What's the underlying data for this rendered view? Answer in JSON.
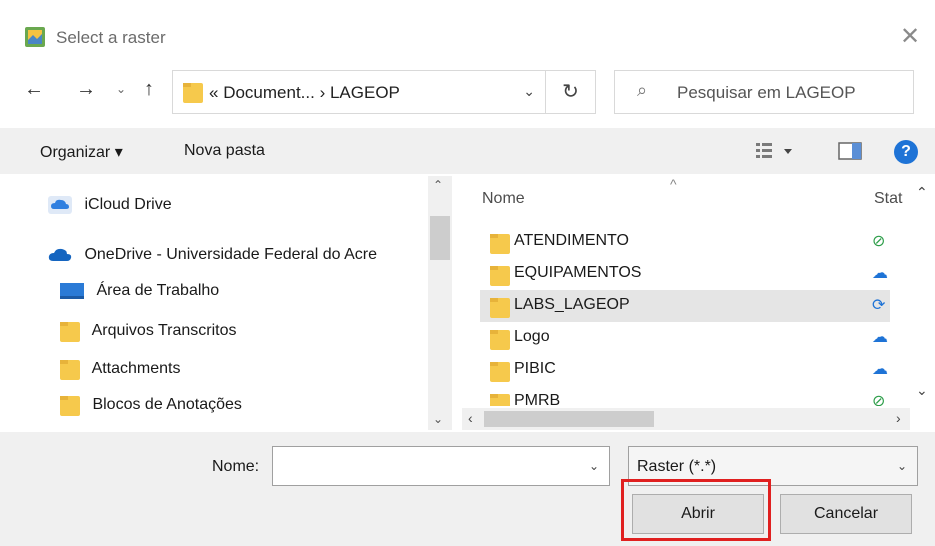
{
  "window": {
    "title": "Select a raster",
    "close_icon": "close-icon"
  },
  "nav": {
    "address_chevron": "«",
    "address_path": "Document... › LAGEOP",
    "search_placeholder": "Pesquisar em LAGEOP"
  },
  "toolbar": {
    "organize_label": "Organizar ▾",
    "new_folder_label": "Nova pasta",
    "help_label": "?"
  },
  "sidebar": {
    "items": [
      {
        "label": "iCloud Drive",
        "icon": "icloud-icon"
      },
      {
        "label": "OneDrive - Universidade Federal do Acre",
        "icon": "onedrive-icon"
      },
      {
        "label": "Área de Trabalho",
        "icon": "desktop-icon"
      },
      {
        "label": "Arquivos Transcritos",
        "icon": "folder-icon"
      },
      {
        "label": "Attachments",
        "icon": "folder-icon"
      },
      {
        "label": "Blocos de Anotações",
        "icon": "folder-icon"
      }
    ]
  },
  "filelist": {
    "columns": {
      "name": "Nome",
      "status": "Stat"
    },
    "rows": [
      {
        "name": "ATENDIMENTO",
        "status": "synced"
      },
      {
        "name": "EQUIPAMENTOS",
        "status": "cloud"
      },
      {
        "name": "LABS_LAGEOP",
        "status": "syncing"
      },
      {
        "name": "Logo",
        "status": "cloud"
      },
      {
        "name": "PIBIC",
        "status": "cloud"
      },
      {
        "name": "PMRB",
        "status": "synced"
      }
    ],
    "selected_index": 2
  },
  "footer": {
    "filename_label": "Nome:",
    "filename_value": "",
    "filetype_value": "Raster (*.*)",
    "open_label": "Abrir",
    "cancel_label": "Cancelar"
  },
  "colors": {
    "highlight": "#e02020",
    "status_synced": "#2e9e4a",
    "status_cloud": "#1e73d6"
  }
}
